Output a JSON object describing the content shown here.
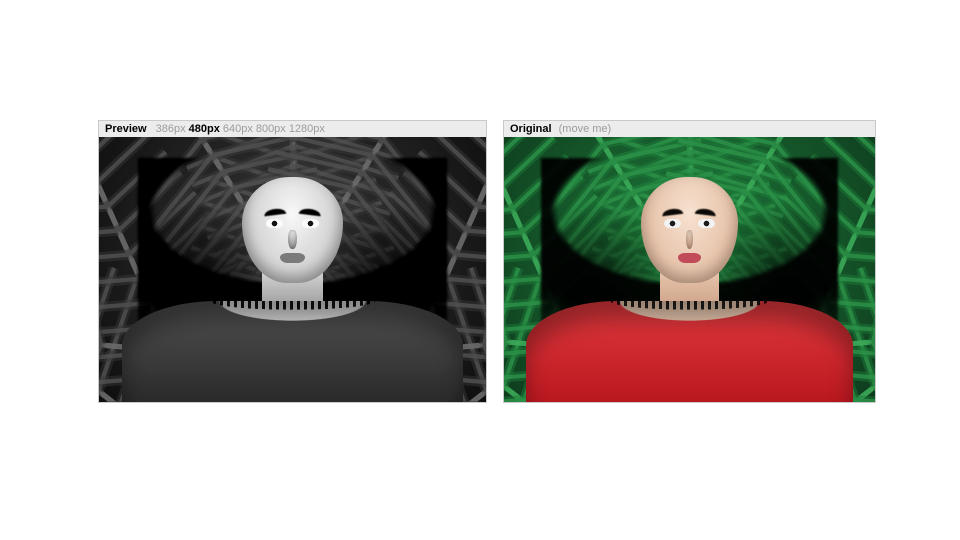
{
  "preview": {
    "label": "Preview",
    "sizes": [
      "386px",
      "480px",
      "640px",
      "800px",
      "1280px"
    ],
    "active_size": "480px"
  },
  "original": {
    "label": "Original",
    "hint": "(move me)"
  }
}
